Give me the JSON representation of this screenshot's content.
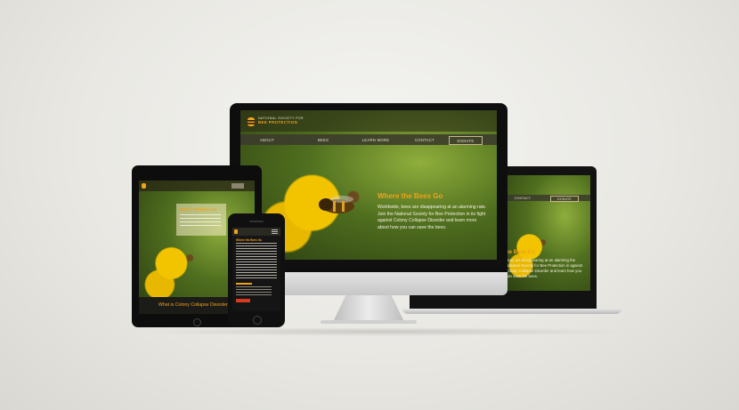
{
  "brand": {
    "name_line1": "NATIONAL SOCIETY FOR",
    "name_line2": "BEE PROTECTION"
  },
  "nav": [
    "ABOUT",
    "BEES",
    "LEARN MORE",
    "CONTACT"
  ],
  "donate": "DONATE",
  "hero": {
    "heading": "Where the Bees Go",
    "body": "Worldwide, bees are disappearing at an alarming rate. Join the National Society for Bee Protection in its fight against Colony Collapse Disorder and learn more about how you can save the bees."
  },
  "laptop": {
    "nav": [
      "CONTACT",
      "DONATE"
    ],
    "heading": "he Bees Go",
    "body": "bees are disappearing at an alarming the National Society for Bee Protection in against Colony Collapse Disorder and learn how you can save the bees."
  },
  "tablet": {
    "heading": "Where the Bees Go",
    "footer_heading": "What is Colony Collapse Disorder"
  },
  "phone": {
    "heading": "Where the Bees Go"
  },
  "colors": {
    "accent": "#f0a21a",
    "nav_bg": "#3b3a2c",
    "device_black": "#111111",
    "background": "#ecebe6"
  }
}
